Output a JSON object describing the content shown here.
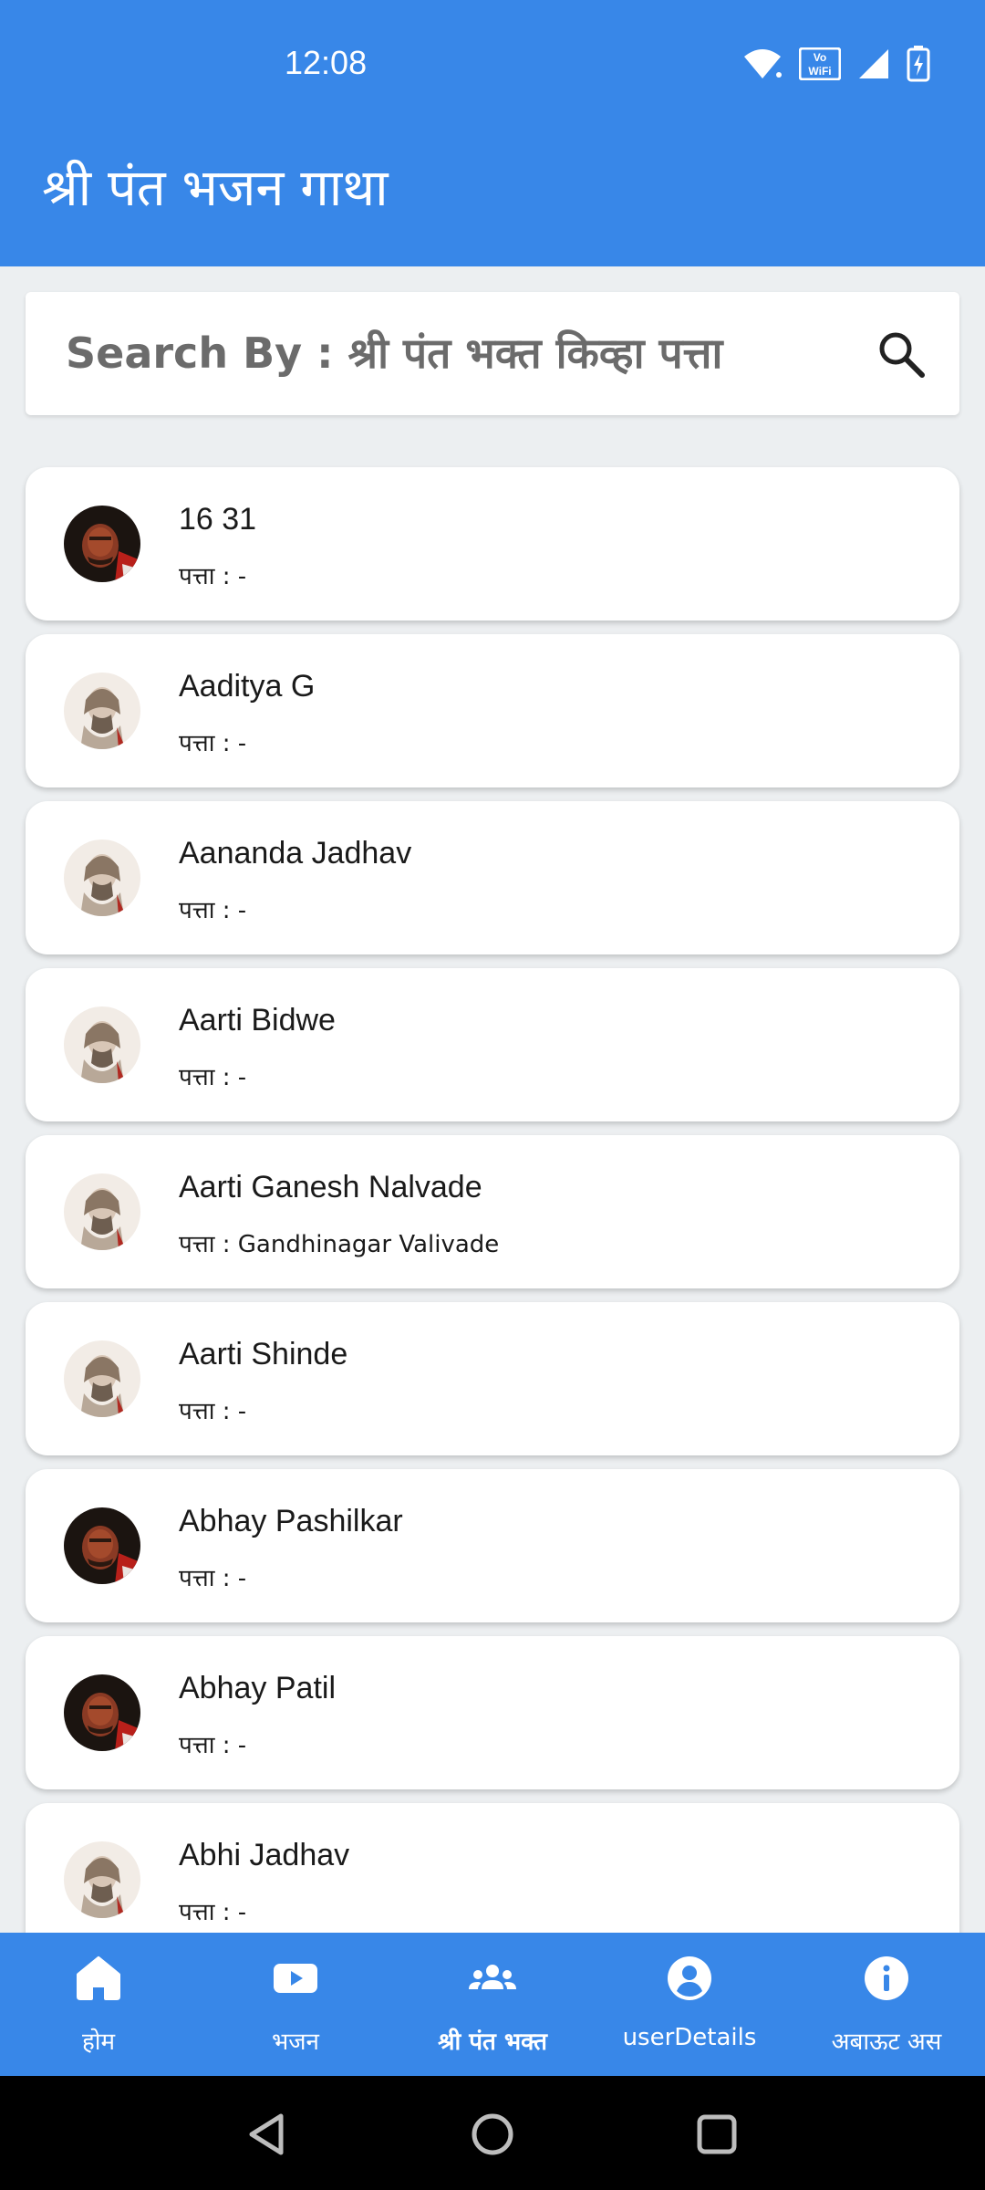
{
  "status_bar": {
    "time": "12:08",
    "icons": [
      "wifi-icon",
      "vowifi-icon",
      "signal-icon",
      "battery-charging-icon"
    ]
  },
  "app_bar": {
    "title": "श्री पंत भजन गाथा"
  },
  "search": {
    "placeholder": "Search By : श्री पंत भक्त किव्हा पत्ता",
    "icon": "search-icon"
  },
  "list": {
    "items": [
      {
        "name": "16 31",
        "address": "पत्ता : -",
        "avatar": "dark"
      },
      {
        "name": "Aaditya G",
        "address": "पत्ता : -",
        "avatar": "sketch"
      },
      {
        "name": "Aananda Jadhav",
        "address": "पत्ता : -",
        "avatar": "sketch"
      },
      {
        "name": "Aarti Bidwe",
        "address": "पत्ता : -",
        "avatar": "sketch"
      },
      {
        "name": "Aarti Ganesh Nalvade",
        "address": "पत्ता : Gandhinagar Valivade",
        "avatar": "sketch"
      },
      {
        "name": "Aarti Shinde",
        "address": "पत्ता : -",
        "avatar": "sketch"
      },
      {
        "name": "Abhay Pashilkar",
        "address": "पत्ता : -",
        "avatar": "dark"
      },
      {
        "name": "Abhay Patil",
        "address": "पत्ता : -",
        "avatar": "dark"
      },
      {
        "name": "Abhi Jadhav",
        "address": "पत्ता : -",
        "avatar": "sketch"
      }
    ]
  },
  "bottom_nav": {
    "items": [
      {
        "label": "होम",
        "icon": "home-icon",
        "active": false
      },
      {
        "label": "भजन",
        "icon": "play-video-icon",
        "active": false
      },
      {
        "label": "श्री पंत भक्त",
        "icon": "group-icon",
        "active": true
      },
      {
        "label": "userDetails",
        "icon": "account-icon",
        "active": false
      },
      {
        "label": "अबाऊट अस",
        "icon": "info-icon",
        "active": false
      }
    ]
  },
  "colors": {
    "primary": "#3887e8",
    "background": "#eceff1",
    "card": "#ffffff"
  }
}
